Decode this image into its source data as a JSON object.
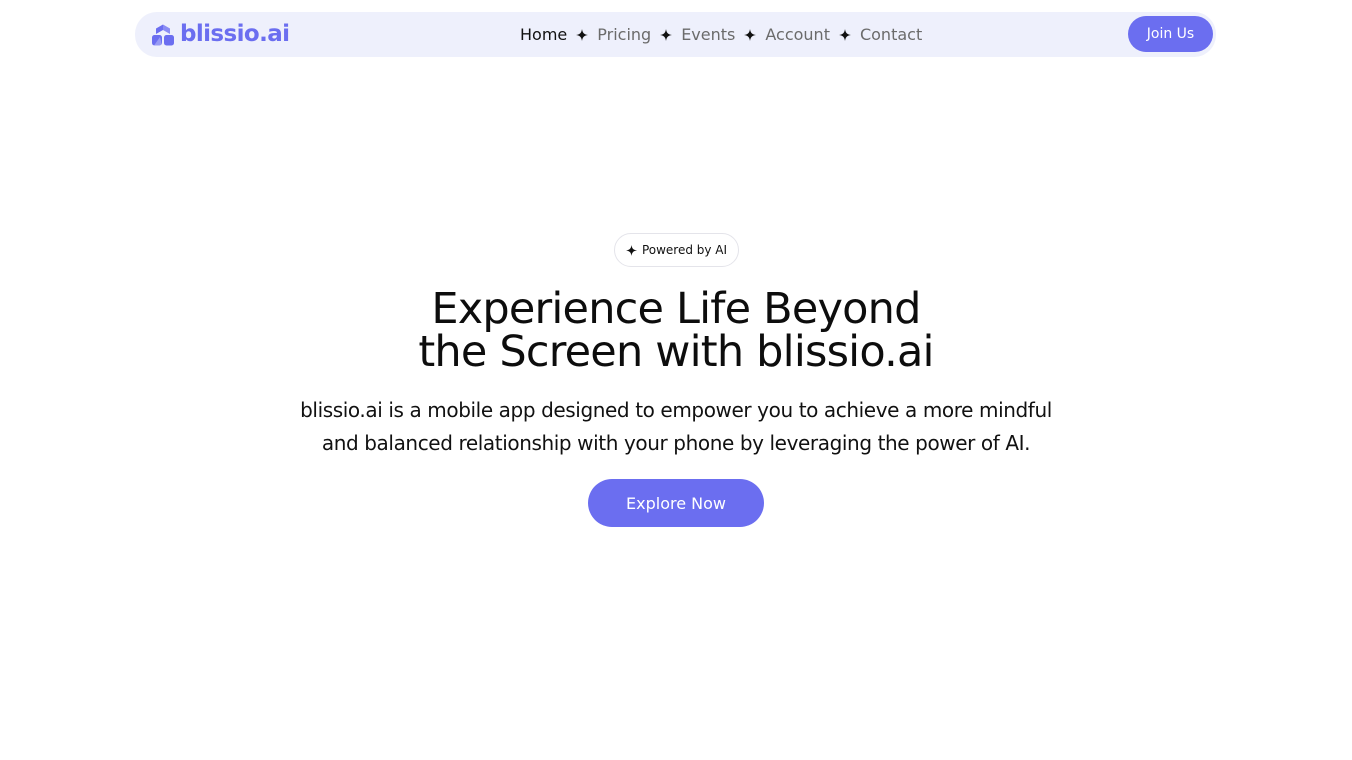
{
  "brand": {
    "name": "blissio.ai",
    "accent_color": "#6b6ef0",
    "nav_background": "#eef0fc",
    "logo_icon": "blissio-logo-icon"
  },
  "nav": {
    "items": [
      {
        "label": "Home",
        "active": true
      },
      {
        "label": "Pricing",
        "active": false
      },
      {
        "label": "Events",
        "active": false
      },
      {
        "label": "Account",
        "active": false
      },
      {
        "label": "Contact",
        "active": false
      }
    ],
    "separator_icon": "sparkle-icon",
    "cta_label": "Join Us"
  },
  "hero": {
    "badge_icon": "sparkle-icon",
    "badge_text": "Powered by AI",
    "headline_line1": "Experience Life Beyond",
    "headline_line2": "the Screen with blissio.ai",
    "subtext_line1": "blissio.ai is a mobile app designed to empower you to achieve a more mindful",
    "subtext_line2": "and balanced relationship with your phone by leveraging the power of AI.",
    "cta_label": "Explore Now"
  }
}
